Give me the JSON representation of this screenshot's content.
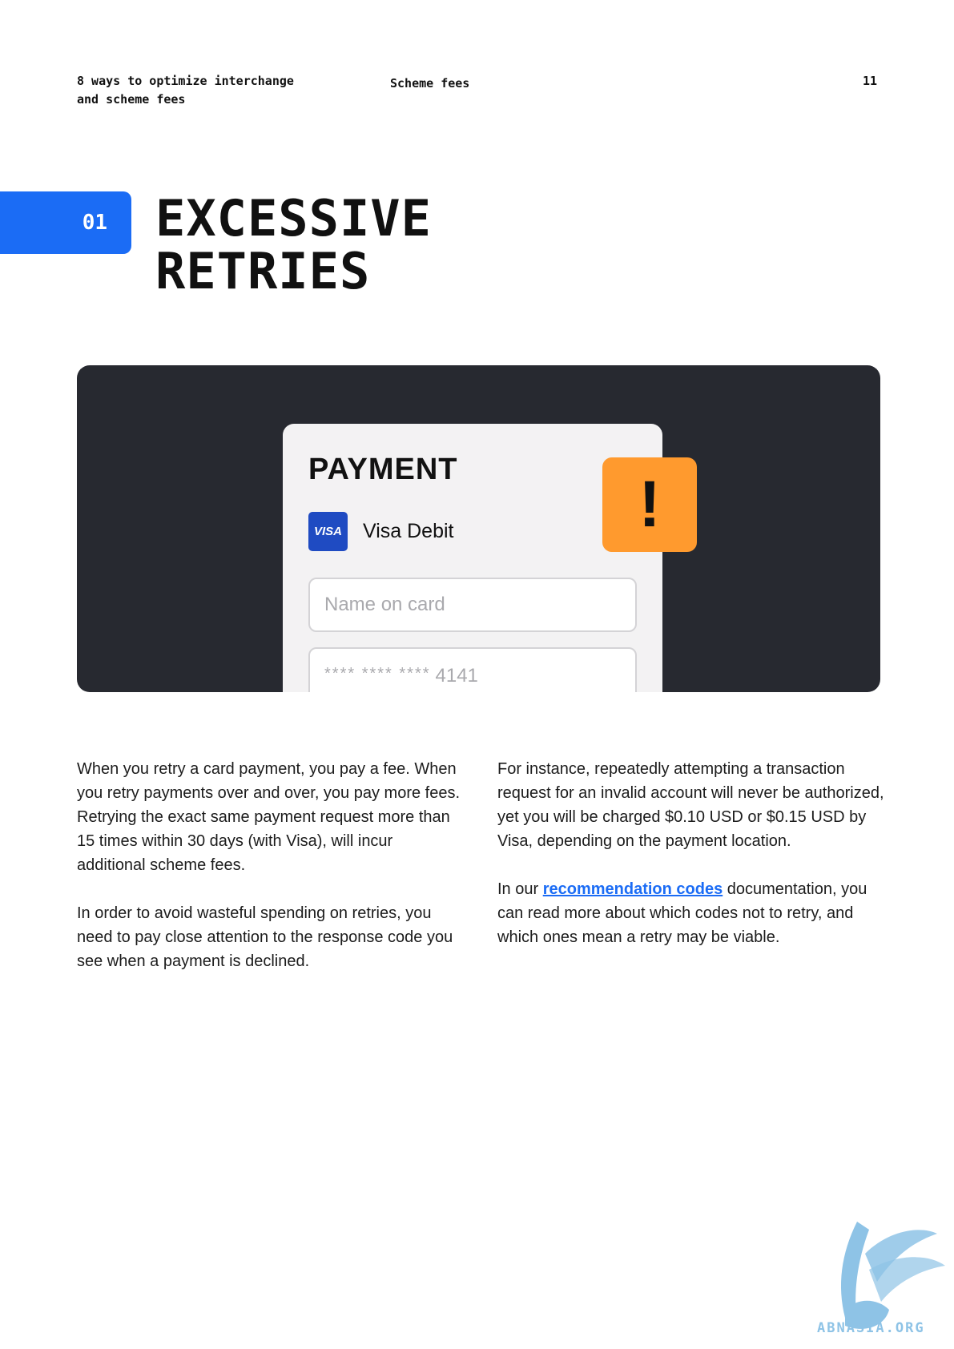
{
  "header": {
    "left_line1": "8 ways to optimize interchange",
    "left_line2": "and scheme fees",
    "center": "Scheme fees",
    "page_number": "11"
  },
  "section": {
    "number": "01",
    "title_line1": "EXCESSIVE",
    "title_line2": "RETRIES"
  },
  "illustration": {
    "card_title": "PAYMENT",
    "visa_logo": "VISA",
    "visa_label": "Visa Debit",
    "name_placeholder": "Name on card",
    "card_mask": "**** **** ****",
    "card_last4": "4141",
    "alert_symbol": "!",
    "colors": {
      "panel": "#272930",
      "alert": "#ff9a2e",
      "visa": "#1f4bc2",
      "accent": "#1b6cf5"
    }
  },
  "body": {
    "left_p1": "When you retry a card payment, you pay a fee. When you retry payments over and over, you pay more fees. Retrying the exact same payment request more than 15 times within 30 days (with Visa), will incur additional scheme fees.",
    "left_p2": "In order to avoid wasteful spending on retries, you need to pay close attention to the response code you see when a payment is declined.",
    "right_p1": "For instance, repeatedly attempting a transaction request for an invalid account will never be authorized, yet you will be charged $0.10 USD or $0.15 USD by Visa, depending on the payment location.",
    "right_p2_before": "In our ",
    "right_p2_link": "recommendation codes",
    "right_p2_after": " documentation, you can read more about which codes not to retry, and which ones mean a retry may be viable."
  },
  "watermark": {
    "text": "ABNASIA.ORG",
    "icon": "griffin-logo"
  }
}
